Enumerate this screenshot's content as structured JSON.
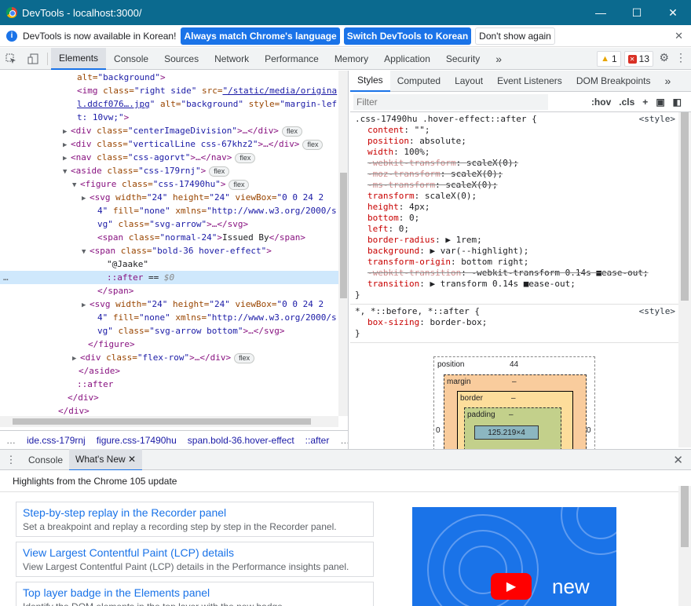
{
  "window": {
    "title": "DevTools - localhost:3000/",
    "minimize": "—",
    "maximize": "☐",
    "close": "✕"
  },
  "infobar": {
    "message": "DevTools is now available in Korean!",
    "btn_match": "Always match Chrome's language",
    "btn_switch": "Switch DevTools to Korean",
    "btn_dismiss": "Don't show again",
    "close": "✕"
  },
  "tabs": [
    "Elements",
    "Console",
    "Sources",
    "Network",
    "Performance",
    "Memory",
    "Application",
    "Security"
  ],
  "more_tabs": "»",
  "warnings": "1",
  "errors": "13",
  "dom": [
    {
      "indent": 98,
      "tri": "",
      "parts": [
        [
          "an",
          "alt="
        ],
        [
          "av",
          "\"background\""
        ],
        [
          "tn",
          ">"
        ]
      ]
    },
    {
      "indent": 98,
      "tri": "",
      "parts": [
        [
          "tn",
          "<img "
        ],
        [
          "an",
          "class="
        ],
        [
          "av",
          "\"right side\" "
        ],
        [
          "an",
          "src="
        ],
        [
          "lk",
          "\"/static/media/origina"
        ]
      ]
    },
    {
      "indent": 98,
      "tri": "",
      "parts": [
        [
          "lk",
          "l.ddcf076….jpg"
        ],
        [
          "av",
          "\" "
        ],
        [
          "an",
          "alt="
        ],
        [
          "av",
          "\"background\" "
        ],
        [
          "an",
          "style="
        ],
        [
          "av",
          "\"margin-lef"
        ]
      ]
    },
    {
      "indent": 98,
      "tri": "",
      "parts": [
        [
          "av",
          "t: 10vw;\""
        ],
        [
          "tn",
          ">"
        ]
      ]
    },
    {
      "indent": 90,
      "tri": "▶",
      "parts": [
        [
          "tn",
          "<div "
        ],
        [
          "an",
          "class="
        ],
        [
          "av",
          "\"centerImageDivision\""
        ],
        [
          "tn",
          ">…</div>"
        ]
      ],
      "pill": "flex"
    },
    {
      "indent": 90,
      "tri": "▶",
      "parts": [
        [
          "tn",
          "<div "
        ],
        [
          "an",
          "class="
        ],
        [
          "av",
          "\"verticalLine css-67khz2\""
        ],
        [
          "tn",
          ">…</div>"
        ]
      ],
      "pill": "flex"
    },
    {
      "indent": 90,
      "tri": "▶",
      "parts": [
        [
          "tn",
          "<nav "
        ],
        [
          "an",
          "class="
        ],
        [
          "av",
          "\"css-agorvt\""
        ],
        [
          "tn",
          ">…</nav>"
        ]
      ],
      "pill": "flex"
    },
    {
      "indent": 90,
      "tri": "▼",
      "parts": [
        [
          "tn",
          "<aside "
        ],
        [
          "an",
          "class="
        ],
        [
          "av",
          "\"css-179rnj\""
        ],
        [
          "tn",
          ">"
        ]
      ],
      "pill": "flex"
    },
    {
      "indent": 102,
      "tri": "▼",
      "parts": [
        [
          "tn",
          "<figure "
        ],
        [
          "an",
          "class="
        ],
        [
          "av",
          "\"css-17490hu\""
        ],
        [
          "tn",
          ">"
        ]
      ],
      "pill": "flex"
    },
    {
      "indent": 114,
      "tri": "▶",
      "parts": [
        [
          "tn",
          "<svg "
        ],
        [
          "an",
          "width="
        ],
        [
          "av",
          "\"24\" "
        ],
        [
          "an",
          "height="
        ],
        [
          "av",
          "\"24\" "
        ],
        [
          "an",
          "viewBox="
        ],
        [
          "av",
          "\"0 0 24 2"
        ]
      ]
    },
    {
      "indent": 124,
      "tri": "",
      "parts": [
        [
          "av",
          "4\" "
        ],
        [
          "an",
          "fill="
        ],
        [
          "av",
          "\"none\" "
        ],
        [
          "an",
          "xmlns="
        ],
        [
          "av",
          "\"http://www.w3.org/2000/s"
        ]
      ]
    },
    {
      "indent": 124,
      "tri": "",
      "parts": [
        [
          "av",
          "vg\" "
        ],
        [
          "an",
          "class="
        ],
        [
          "av",
          "\"svg-arrow\""
        ],
        [
          "tn",
          ">…</svg>"
        ]
      ]
    },
    {
      "indent": 124,
      "tri": "",
      "parts": [
        [
          "tn",
          "<span "
        ],
        [
          "an",
          "class="
        ],
        [
          "av",
          "\"normal-24\""
        ],
        [
          "tn",
          ">"
        ],
        [
          "tx",
          "Issued By"
        ],
        [
          "tn",
          "</span>"
        ]
      ]
    },
    {
      "indent": 114,
      "tri": "▼",
      "parts": [
        [
          "tn",
          "<span "
        ],
        [
          "an",
          "class="
        ],
        [
          "av",
          "\"bold-36 hover-effect\""
        ],
        [
          "tn",
          ">"
        ]
      ]
    },
    {
      "indent": 136,
      "tri": "",
      "parts": [
        [
          "tx",
          "\"@Jaake\""
        ]
      ]
    },
    {
      "indent": 136,
      "tri": "",
      "parts": [
        [
          "tn",
          "::after"
        ],
        [
          "tx",
          " == "
        ],
        [
          "tx",
          "$0"
        ]
      ],
      "sel": true
    },
    {
      "indent": 124,
      "tri": "",
      "parts": [
        [
          "tn",
          "</span>"
        ]
      ]
    },
    {
      "indent": 114,
      "tri": "▶",
      "parts": [
        [
          "tn",
          "<svg "
        ],
        [
          "an",
          "width="
        ],
        [
          "av",
          "\"24\" "
        ],
        [
          "an",
          "height="
        ],
        [
          "av",
          "\"24\" "
        ],
        [
          "an",
          "viewBox="
        ],
        [
          "av",
          "\"0 0 24 2"
        ]
      ]
    },
    {
      "indent": 124,
      "tri": "",
      "parts": [
        [
          "av",
          "4\" "
        ],
        [
          "an",
          "fill="
        ],
        [
          "av",
          "\"none\" "
        ],
        [
          "an",
          "xmlns="
        ],
        [
          "av",
          "\"http://www.w3.org/2000/s"
        ]
      ]
    },
    {
      "indent": 124,
      "tri": "",
      "parts": [
        [
          "av",
          "vg\" "
        ],
        [
          "an",
          "class="
        ],
        [
          "av",
          "\"svg-arrow bottom\""
        ],
        [
          "tn",
          ">…</svg>"
        ]
      ]
    },
    {
      "indent": 112,
      "tri": "",
      "parts": [
        [
          "tn",
          "</figure>"
        ]
      ]
    },
    {
      "indent": 102,
      "tri": "▶",
      "parts": [
        [
          "tn",
          "<div "
        ],
        [
          "an",
          "class="
        ],
        [
          "av",
          "\"flex-row\""
        ],
        [
          "tn",
          ">…</div>"
        ]
      ],
      "pill": "flex"
    },
    {
      "indent": 100,
      "tri": "",
      "parts": [
        [
          "tn",
          "</aside>"
        ]
      ]
    },
    {
      "indent": 98,
      "tri": "",
      "parts": [
        [
          "tn",
          "::after"
        ]
      ]
    },
    {
      "indent": 86,
      "tri": "",
      "parts": [
        [
          "tn",
          "</div>"
        ]
      ]
    },
    {
      "indent": 74,
      "tri": "",
      "parts": [
        [
          "tn",
          "</div>"
        ]
      ]
    }
  ],
  "breadcrumbs": [
    "…",
    "ide.css-179rnj",
    "figure.css-17490hu",
    "span.bold-36.hover-effect",
    "::after",
    "…"
  ],
  "styles_tabs": [
    "Styles",
    "Computed",
    "Layout",
    "Event Listeners",
    "DOM Breakpoints"
  ],
  "styles_more": "»",
  "filter": {
    "placeholder": "Filter",
    "hov": ":hov",
    "cls": ".cls",
    "plus": "+"
  },
  "rules": [
    {
      "selector": ".css-17490hu .hover-effect::after {",
      "source": "<style>",
      "props": [
        {
          "n": "content",
          "v": "\"\";"
        },
        {
          "n": "position",
          "v": "absolute;"
        },
        {
          "n": "width",
          "v": "100%;"
        },
        {
          "n": "-webkit-transform",
          "v": "scaleX(0);",
          "strike": true
        },
        {
          "n": "-moz-transform",
          "v": "scaleX(0);",
          "strike": true
        },
        {
          "n": "-ms-transform",
          "v": "scaleX(0);",
          "strike": true
        },
        {
          "n": "transform",
          "v": "scaleX(0);"
        },
        {
          "n": "height",
          "v": "4px;"
        },
        {
          "n": "bottom",
          "v": "0;"
        },
        {
          "n": "left",
          "v": "0;"
        },
        {
          "n": "border-radius",
          "v": "▶ 1rem;"
        },
        {
          "n": "background",
          "v": "▶ var(--highlight);"
        },
        {
          "n": "transform-origin",
          "v": "bottom right;"
        },
        {
          "n": "-webkit-transition",
          "v": "-webkit-transform 0.14s ■ease-out;",
          "strike": true
        },
        {
          "n": "transition",
          "v": "▶ transform 0.14s ■ease-out;"
        }
      ]
    },
    {
      "selector": "*, *::before, *::after {",
      "source": "<style>",
      "props": [
        {
          "n": "box-sizing",
          "v": "border-box;"
        }
      ]
    }
  ],
  "boxmodel": {
    "position": "position",
    "pos_top": "44",
    "margin": "margin",
    "margin_val": "–",
    "border": "border",
    "border_val": "–",
    "padding": "padding",
    "padding_val": "–",
    "content": "125.219×4",
    "left": "0",
    "right": "0"
  },
  "drawer": {
    "tabs": [
      "Console",
      "What's New"
    ],
    "close_tab": "✕",
    "close": "✕"
  },
  "whatsnew": {
    "highlight": "Highlights from the Chrome 105 update",
    "cards": [
      {
        "title": "Step-by-step replay in the Recorder panel",
        "desc": "Set a breakpoint and replay a recording step by step in the Recorder panel."
      },
      {
        "title": "View Largest Contentful Paint (LCP) details",
        "desc": "View Largest Contentful Paint (LCP) details in the Performance insights panel."
      },
      {
        "title": "Top layer badge in the Elements panel",
        "desc": "Identify the DOM elements in the top layer with the new badge."
      }
    ],
    "video_text": "new"
  }
}
